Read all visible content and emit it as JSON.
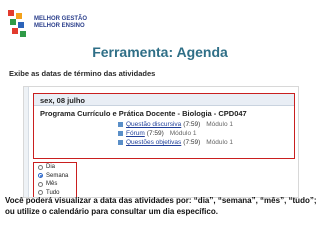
{
  "logo": {
    "line1": "MELHOR GESTÃO",
    "line2": "MELHOR ENSINO",
    "colors": [
      "#e23b2e",
      "#f3a21b",
      "#2f9a47",
      "#2b63b9"
    ]
  },
  "title": "Ferramenta: Agenda",
  "subtitle": "Exibe as datas de término das atividades",
  "calendar": {
    "date": "sex, 08 julho",
    "course": "Programa Currículo e Prática Docente - Biologia - CPD047",
    "activities": [
      {
        "name": "Questão discursiva",
        "time": "(7:59)",
        "module": "Módulo 1"
      },
      {
        "name": "Fórum",
        "time": "(7:59)",
        "module": "Módulo 1"
      },
      {
        "name": "Questões objetivas",
        "time": "(7:59)",
        "module": "Módulo 1"
      }
    ],
    "views": [
      "Dia",
      "Semana",
      "Mês",
      "Tudo"
    ],
    "selected_view": "Semana"
  },
  "caption": "Você poderá visualizar a data das atividades por: “dia”, “semana”, “mês”, “tudo”; ou utilize o calendário para consultar um dia específico.",
  "colors": {
    "title": "#2f6f87",
    "highlight": "#c91f1f",
    "link": "#1f3f9a"
  }
}
